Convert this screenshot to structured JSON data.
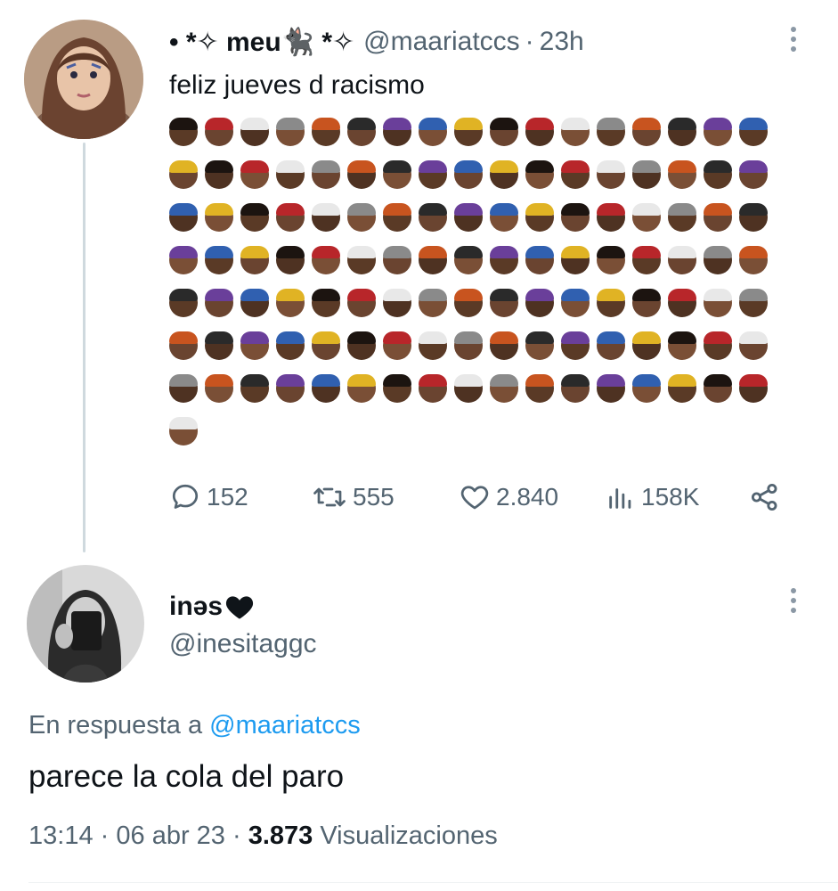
{
  "tweet": {
    "display_name": "• *✧ meu🐈‍⬛ *✧",
    "handle": "@maariatccs",
    "separator": "·",
    "time": "23h",
    "text": "feliz jueves d racismo",
    "actions": {
      "replies": "152",
      "retweets": "555",
      "likes": "2.840",
      "views": "158K"
    }
  },
  "reply": {
    "display_name": "inəs",
    "handle": "@inesitaggc",
    "reply_prefix": "En respuesta a ",
    "reply_to": "@maariatccs",
    "text": "parece la cola del paro",
    "time": "13:14",
    "date": "06 abr 23",
    "separator": "·",
    "views_count": "3.873",
    "views_label": "Visualizaciones"
  },
  "colors": {
    "accent": "#1d9bf0",
    "secondary_text": "#536471",
    "primary_text": "#0f1419",
    "thread_line": "#cfd9de"
  },
  "icons": [
    "reply-icon",
    "retweet-icon",
    "like-icon",
    "views-icon",
    "share-icon",
    "more-icon",
    "black-heart-icon"
  ]
}
